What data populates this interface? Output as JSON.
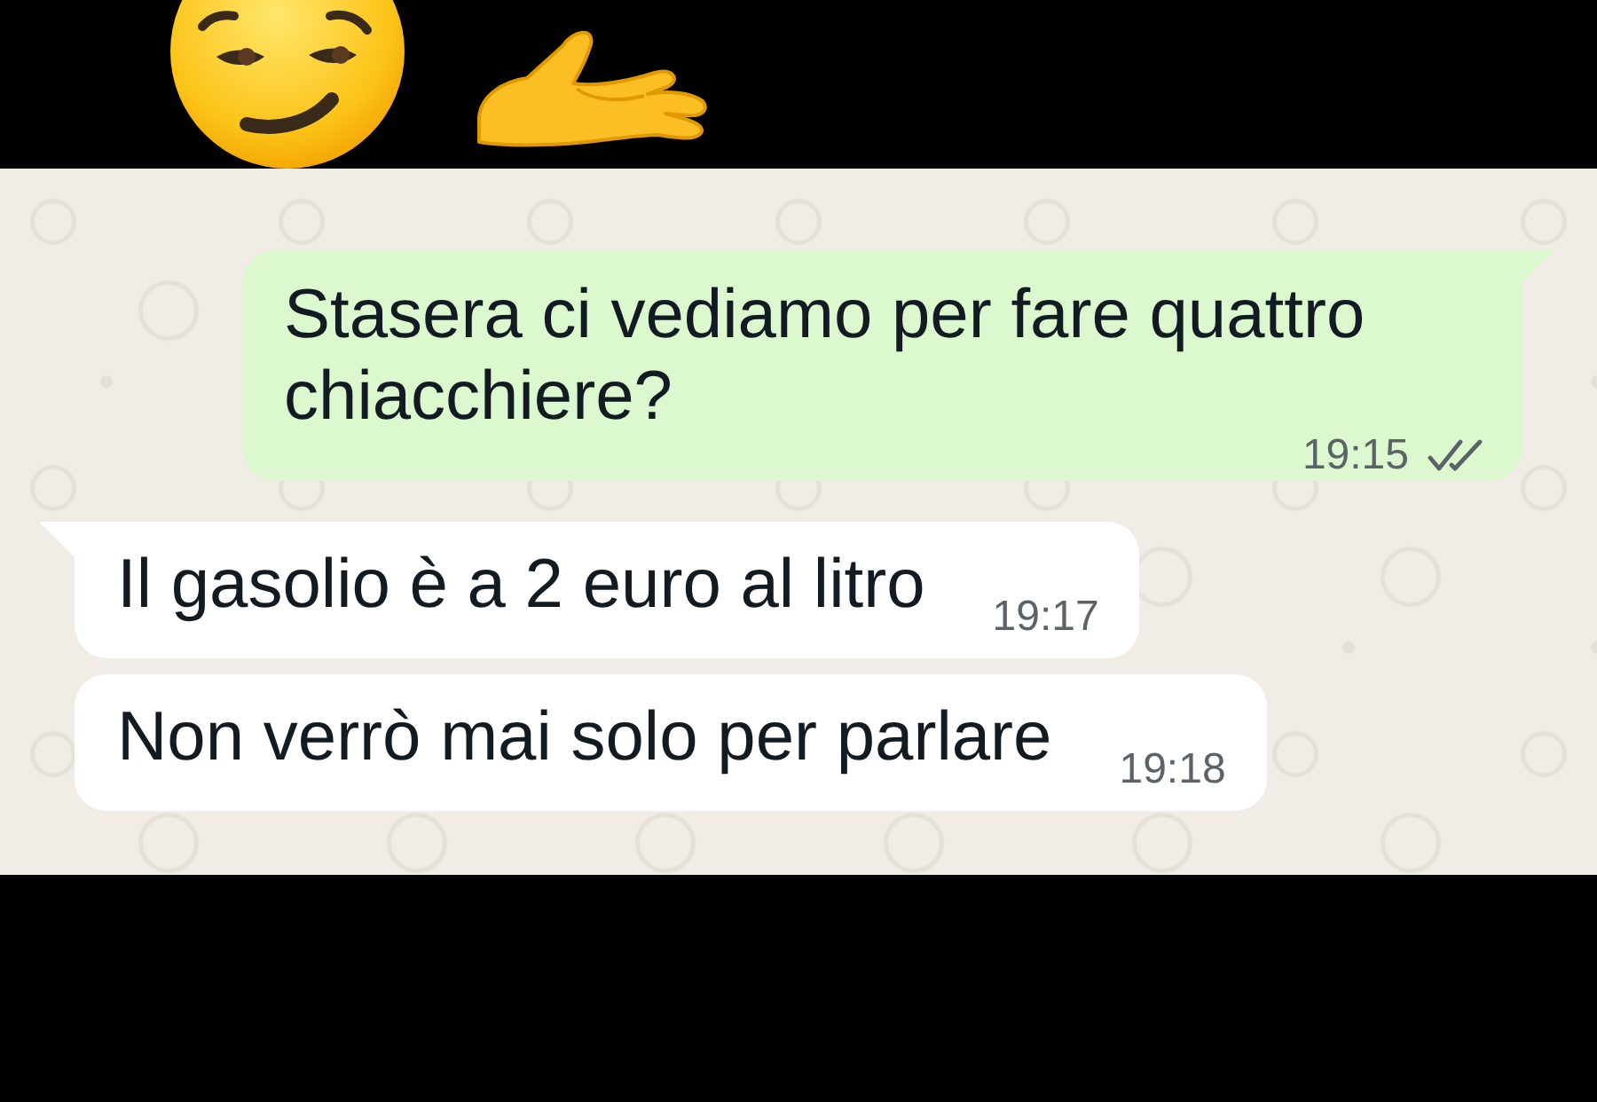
{
  "messages": [
    {
      "kind": "outgoing",
      "text": "Stasera ci vediamo per fare quattro chiacchiere?",
      "time": "19:15",
      "delivered": true,
      "read": false
    },
    {
      "kind": "incoming",
      "text": "Il gasolio è a 2 euro al litro",
      "time": "19:17"
    },
    {
      "kind": "incoming",
      "text": "Non verrò mai solo per parlare",
      "time": "19:18"
    }
  ]
}
